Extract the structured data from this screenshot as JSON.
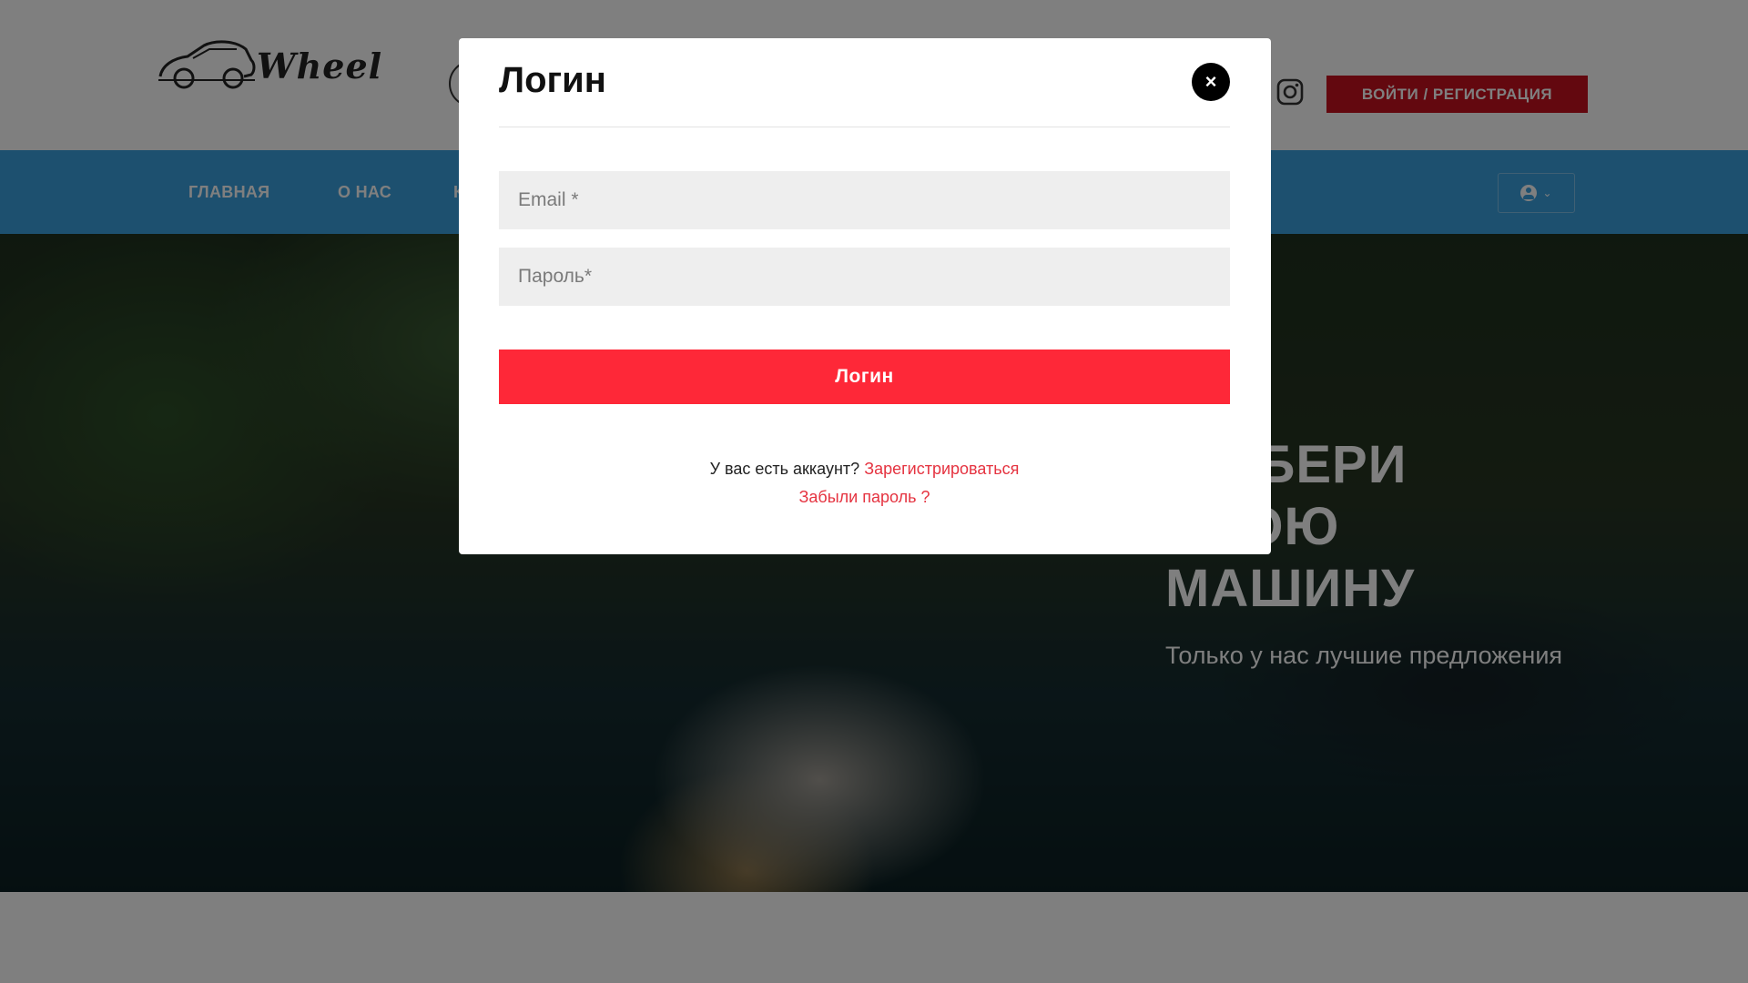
{
  "header": {
    "logo_text": "Wheel",
    "auth_button": "ВОЙТИ / РЕГИСТРАЦИЯ"
  },
  "nav": {
    "items": [
      {
        "label": "ГЛАВНАЯ"
      },
      {
        "label": "О НАС"
      },
      {
        "label": "К"
      }
    ]
  },
  "hero": {
    "title_line1": "ВЫБЕРИ",
    "title_line2": "СВОЮ",
    "title_line3": "МАШИНУ",
    "subtitle": "Только у нас лучшие предложения"
  },
  "modal": {
    "title": "Логин",
    "close_glyph": "×",
    "email_placeholder": "Email *",
    "password_placeholder": "Пароль*",
    "submit_label": "Логин",
    "have_account_text": "У вас есть аккаунт?",
    "register_link": "Зарегистрироваться",
    "forgot_link": "Забыли пароль ?"
  },
  "colors": {
    "nav_blue": "#3aa0de",
    "auth_red": "#c7101f",
    "submit_red": "#fe2838",
    "link_red": "#e53340"
  },
  "icons": {
    "instagram": "instagram-icon",
    "user": "user-icon",
    "close": "close-icon",
    "search": "search-icon"
  }
}
